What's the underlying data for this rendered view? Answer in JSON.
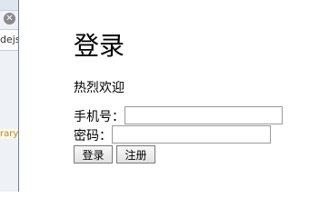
{
  "side_panel": {
    "close_glyph": "✕",
    "tab_text": "dejs",
    "hint_text": "rary"
  },
  "login": {
    "title": "登录",
    "welcome": "热烈欢迎",
    "phone_label": "手机号：",
    "phone_value": "",
    "password_label": "密码：",
    "password_value": "",
    "login_button": "登录",
    "register_button": "注册"
  }
}
